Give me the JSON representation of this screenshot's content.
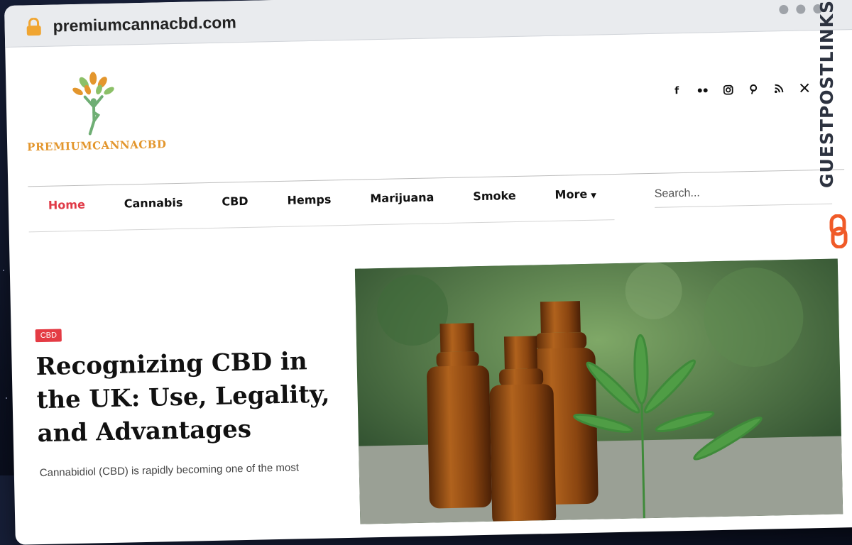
{
  "browser": {
    "url": "premiumcannacbd.com"
  },
  "site": {
    "logo_text": "PREMIUMCANNACBD",
    "social_icons": [
      "facebook-icon",
      "flickr-icon",
      "instagram-icon",
      "pinterest-icon",
      "rss-icon",
      "x-icon"
    ]
  },
  "nav": {
    "items": [
      "Home",
      "Cannabis",
      "CBD",
      "Hemps",
      "Marijuana",
      "Smoke",
      "More"
    ],
    "active": "Home"
  },
  "search": {
    "placeholder": "Search..."
  },
  "featured": {
    "category": "CBD",
    "title": "Recognizing CBD in the UK: Use, Legality, and Advantages",
    "excerpt": "Cannabidiol (CBD) is rapidly becoming one of the most"
  },
  "brand_overlay": {
    "text": "GUESTPOSTLINKS"
  },
  "colors": {
    "accent": "#e03a47",
    "logo_orange": "#e3962d",
    "logo_green": "#6fae74"
  }
}
